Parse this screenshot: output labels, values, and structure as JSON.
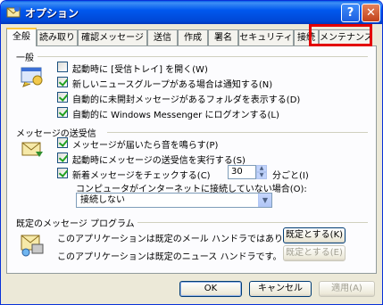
{
  "window": {
    "title": "オプション",
    "help_label": "?",
    "close_label": "✕"
  },
  "tabs": [
    {
      "label": "全般"
    },
    {
      "label": "読み取り"
    },
    {
      "label": "確認メッセージ"
    },
    {
      "label": "送信"
    },
    {
      "label": "作成"
    },
    {
      "label": "署名"
    },
    {
      "label": "セキュリティ"
    },
    {
      "label": "接続"
    },
    {
      "label": "メンテナンス"
    }
  ],
  "general": {
    "heading": "一般",
    "options": [
      {
        "label": "起動時に [受信トレイ] を開く(W)",
        "checked": false
      },
      {
        "label": "新しいニュースグループがある場合は通知する(N)",
        "checked": true
      },
      {
        "label": "自動的に未開封メッセージがあるフォルダを表示する(D)",
        "checked": true
      },
      {
        "label": "自動的に Windows Messenger にログオンする(L)",
        "checked": true
      }
    ]
  },
  "send_receive": {
    "heading": "メッセージの送受信",
    "options": [
      {
        "label": "メッセージが届いたら音を鳴らす(P)",
        "checked": true
      },
      {
        "label": "起動時にメッセージの送受信を実行する(S)",
        "checked": true
      },
      {
        "label": "新着メッセージをチェックする(C)",
        "checked": true
      }
    ],
    "interval_value": "30",
    "interval_unit": "分ごと(I)",
    "offline_label": "コンピュータがインターネットに接続していない場合(O):",
    "offline_selected": "接続しない"
  },
  "default_programs": {
    "heading": "既定のメッセージ プログラム",
    "mail_text": "このアプリケーションは既定のメール ハンドラではありません。",
    "mail_button": "既定とする(K)",
    "news_text": "このアプリケーションは既定のニュース ハンドラです。",
    "news_button": "既定とする(E)"
  },
  "footer": {
    "ok": "OK",
    "cancel": "キャンセル",
    "apply": "適用(A)"
  },
  "colors": {
    "titlebar": "#0054e3",
    "highlight": "#e30000",
    "face": "#ece9d8"
  }
}
